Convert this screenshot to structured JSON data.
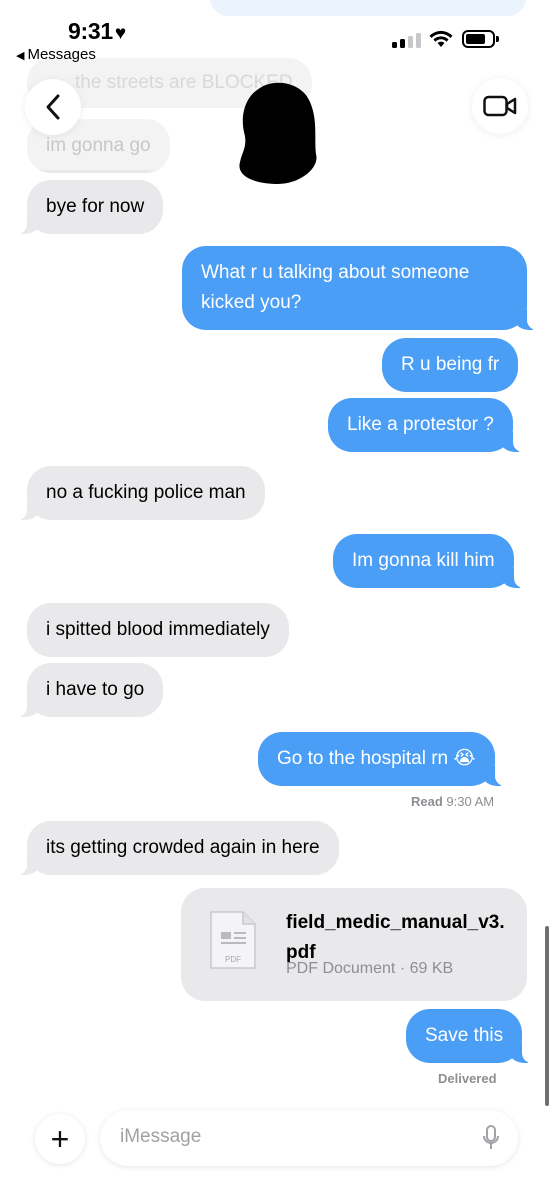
{
  "status": {
    "time": "9:31",
    "heart": "♥",
    "back_app": "Messages"
  },
  "nav": {
    "back_icon": "chevron-left-icon",
    "video_icon": "video-camera-icon"
  },
  "messages": {
    "m0": "the streets are BLOCKED",
    "m1": "im gonna go",
    "m2": "bye for now",
    "m3": "What r u talking about someone kicked you?",
    "m4": "R u being fr",
    "m5": "Like a protestor ?",
    "m6": "no a fucking police man",
    "m7": "Im gonna kill him",
    "m8": "i spitted blood immediately",
    "m9": "i have to go",
    "m10": "Go to the hospital rn 😭",
    "m11": "its getting crowded again in here",
    "m12": "Save this"
  },
  "read_receipt": {
    "label": "Read",
    "time": "9:30 AM"
  },
  "attachment": {
    "filename": "field_medic_manual_v3.pdf",
    "meta": "PDF Document · 69 KB",
    "icon_label": "PDF"
  },
  "delivered": "Delivered",
  "composer": {
    "placeholder": "iMessage"
  },
  "colors": {
    "outgoing": "#4b9ef5",
    "incoming": "#e9e9eb"
  }
}
